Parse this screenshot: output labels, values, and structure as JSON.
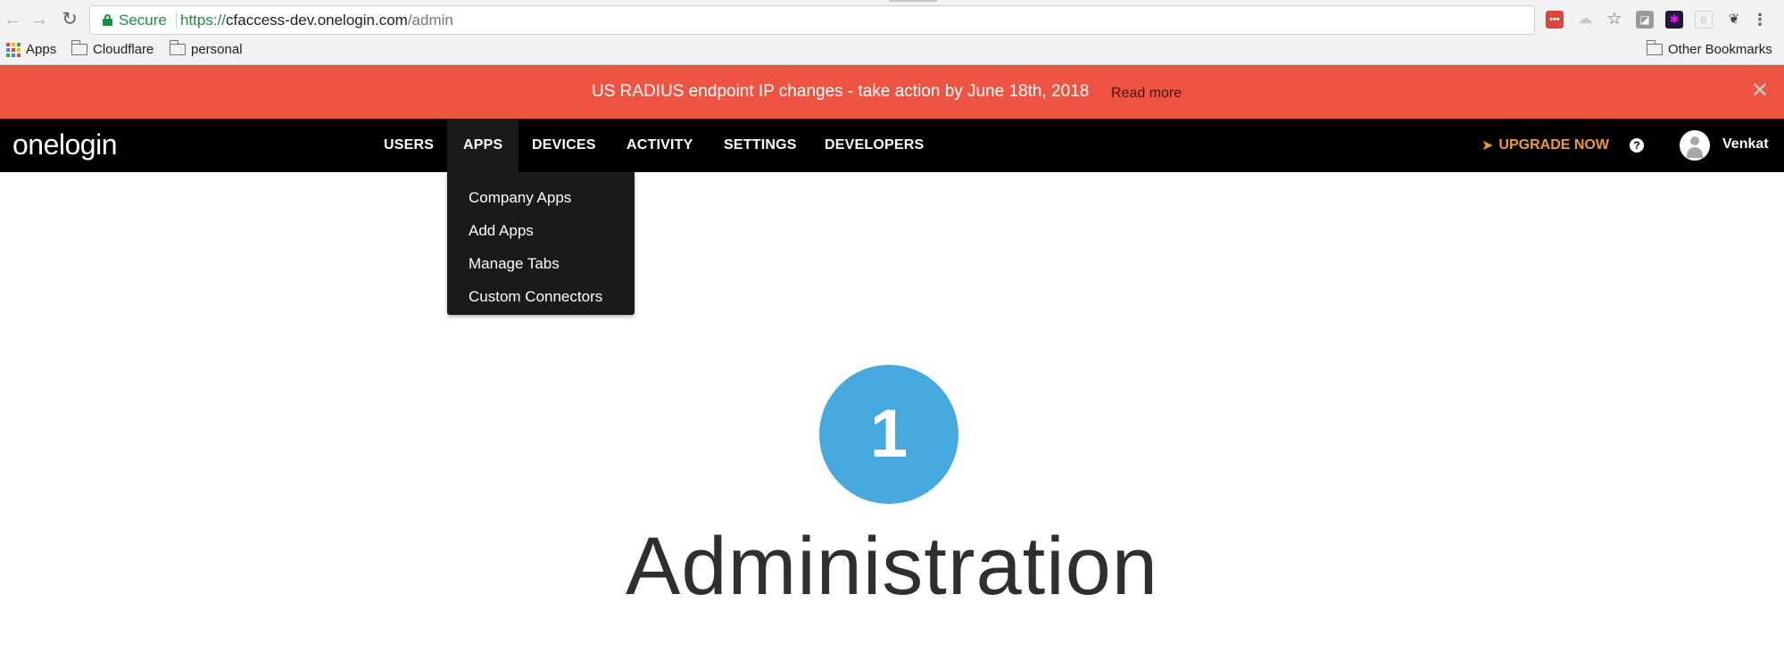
{
  "browser": {
    "secure_label": "Secure",
    "url_scheme": "https://",
    "url_host": "cfaccess-dev.onelogin.com",
    "url_path": "/admin",
    "bookmarks": [
      {
        "label": "Apps"
      },
      {
        "label": "Cloudflare"
      },
      {
        "label": "personal"
      }
    ],
    "other_bookmarks": "Other Bookmarks"
  },
  "banner": {
    "message": "US RADIUS endpoint IP changes - take action by June 18th, 2018",
    "link": "Read more",
    "close": "✕",
    "color": "#ef5443"
  },
  "nav": {
    "logo": "onelogin",
    "items": [
      "USERS",
      "APPS",
      "DEVICES",
      "ACTIVITY",
      "SETTINGS",
      "DEVELOPERS"
    ],
    "active": "APPS",
    "upgrade": "UPGRADE NOW",
    "upgrade_color": "#f19a33",
    "help": "?",
    "user": "Venkat"
  },
  "apps_menu": {
    "items": [
      "Company Apps",
      "Add Apps",
      "Manage Tabs",
      "Custom Connectors"
    ]
  },
  "main": {
    "badge_number": "1",
    "badge_color": "#46a9de",
    "title": "Administration"
  }
}
